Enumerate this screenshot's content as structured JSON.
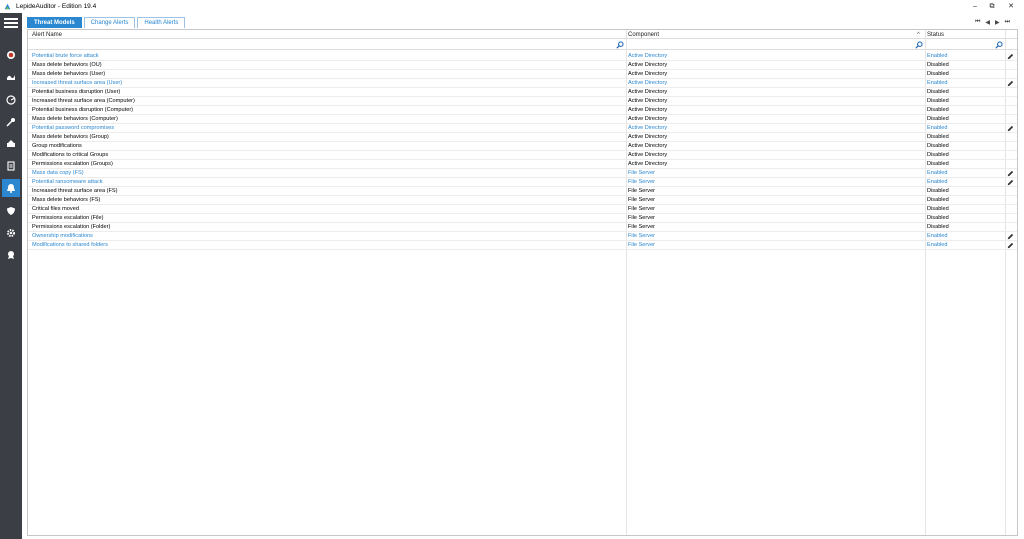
{
  "window": {
    "title": "LepideAuditor - Edition 19.4",
    "minimize": "–",
    "restore": "⧉",
    "close": "✕"
  },
  "tabs": [
    {
      "label": "Threat Models",
      "active": true
    },
    {
      "label": "Change Alerts",
      "active": false
    },
    {
      "label": "Health Alerts",
      "active": false
    }
  ],
  "pager": {
    "first": "⏮",
    "prev": "◀",
    "next": "▶",
    "last": "⏭"
  },
  "columns": {
    "alert_name": "Alert Name",
    "component": "Component",
    "status": "Status"
  },
  "sort_indicator": "^",
  "rows": [
    {
      "name": "Potential brute force attack",
      "component": "Active Directory",
      "status": "Enabled"
    },
    {
      "name": "Mass delete behaviors (OU)",
      "component": "Active Directory",
      "status": "Disabled"
    },
    {
      "name": "Mass delete behaviors (User)",
      "component": "Active Directory",
      "status": "Disabled"
    },
    {
      "name": "Increased threat surface area (User)",
      "component": "Active Directory",
      "status": "Enabled"
    },
    {
      "name": "Potential business disruption (User)",
      "component": "Active Directory",
      "status": "Disabled"
    },
    {
      "name": "Increased threat surface area (Computer)",
      "component": "Active Directory",
      "status": "Disabled"
    },
    {
      "name": "Potential business disruption (Computer)",
      "component": "Active Directory",
      "status": "Disabled"
    },
    {
      "name": "Mass delete behaviors (Computer)",
      "component": "Active Directory",
      "status": "Disabled"
    },
    {
      "name": "Potential password compromises",
      "component": "Active Directory",
      "status": "Enabled"
    },
    {
      "name": "Mass delete behaviors (Group)",
      "component": "Active Directory",
      "status": "Disabled"
    },
    {
      "name": "Group modifications",
      "component": "Active Directory",
      "status": "Disabled"
    },
    {
      "name": "Modifications to critical Groups",
      "component": "Active Directory",
      "status": "Disabled"
    },
    {
      "name": "Permissions escalation (Groups)",
      "component": "Active Directory",
      "status": "Disabled"
    },
    {
      "name": "Mass data copy (FS)",
      "component": "File Server",
      "status": "Enabled"
    },
    {
      "name": "Potential ransomware attack",
      "component": "File Server",
      "status": "Enabled"
    },
    {
      "name": "Increased threat surface area (FS)",
      "component": "File Server",
      "status": "Disabled"
    },
    {
      "name": "Mass delete behaviors (FS)",
      "component": "File Server",
      "status": "Disabled"
    },
    {
      "name": "Critical files moved",
      "component": "File Server",
      "status": "Disabled"
    },
    {
      "name": "Permissions escalation (File)",
      "component": "File Server",
      "status": "Disabled"
    },
    {
      "name": "Permissions escalation (Folder)",
      "component": "File Server",
      "status": "Disabled"
    },
    {
      "name": "Ownership modifications",
      "component": "File Server",
      "status": "Enabled"
    },
    {
      "name": "Modifications to shared folders",
      "component": "File Server",
      "status": "Enabled"
    }
  ],
  "colors": {
    "accent": "#2a87d0",
    "sidebar": "#3b3e45"
  },
  "sidebar_icons": [
    "menu-icon",
    "dashboard-icon",
    "reports-icon",
    "radar-icon",
    "key-icon",
    "permissions-icon",
    "document-icon",
    "alerts-icon",
    "shield-icon",
    "settings-icon",
    "license-icon"
  ]
}
